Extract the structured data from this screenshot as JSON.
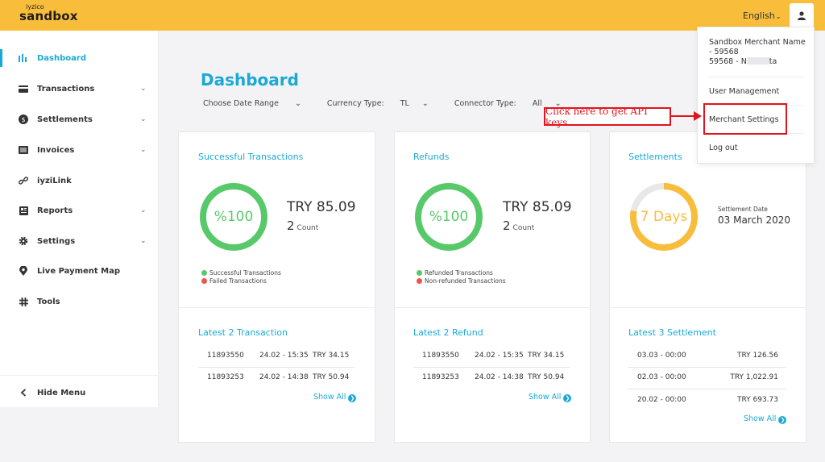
{
  "header": {
    "logo_small": "iyzico",
    "logo_big": "sandbox",
    "language": "English"
  },
  "sidebar": {
    "items": [
      {
        "label": "Dashboard",
        "icon": "bar-chart-icon",
        "active": true,
        "caret": false
      },
      {
        "label": "Transactions",
        "icon": "card-icon",
        "caret": true
      },
      {
        "label": "Settlements",
        "icon": "coin-icon",
        "caret": true
      },
      {
        "label": "Invoices",
        "icon": "list-icon",
        "caret": true
      },
      {
        "label": "iyziLink",
        "icon": "link-icon",
        "caret": false
      },
      {
        "label": "Reports",
        "icon": "report-icon",
        "caret": true
      },
      {
        "label": "Settings",
        "icon": "gear-icon",
        "caret": true
      },
      {
        "label": "Live Payment Map",
        "icon": "map-pin-icon",
        "caret": false
      },
      {
        "label": "Tools",
        "icon": "hash-icon",
        "caret": false
      }
    ],
    "hide_menu": "Hide Menu"
  },
  "main": {
    "title": "Dashboard",
    "filters": {
      "date_range": "Choose Date Range",
      "currency_label": "Currency Type:",
      "currency_value": "TL",
      "connector_label": "Connector Type:",
      "connector_value": "All"
    },
    "cards": {
      "transactions": {
        "title": "Successful Transactions",
        "percent": "%100",
        "percent_value": 100,
        "amount": "TRY 85.09",
        "count": "2",
        "count_label": "Count",
        "legend": [
          "Successful Transactions",
          "Failed Transactions"
        ],
        "latest_title": "Latest 2 Transaction",
        "rows": [
          {
            "id": "11893550",
            "date": "24.02 - 15:35",
            "amount": "TRY 34.15"
          },
          {
            "id": "11893253",
            "date": "24.02 - 14:38",
            "amount": "TRY 50.94"
          }
        ],
        "show_all": "Show All"
      },
      "refunds": {
        "title": "Refunds",
        "percent": "%100",
        "percent_value": 100,
        "amount": "TRY 85.09",
        "count": "2",
        "count_label": "Count",
        "legend": [
          "Refunded Transactions",
          "Non-refunded Transactions"
        ],
        "latest_title": "Latest 2 Refund",
        "rows": [
          {
            "id": "11893550",
            "date": "24.02 - 15:35",
            "amount": "TRY 34.15"
          },
          {
            "id": "11893253",
            "date": "24.02 - 14:38",
            "amount": "TRY 50.94"
          }
        ],
        "show_all": "Show All"
      },
      "settlements": {
        "title": "Settlements",
        "days": "7 Days",
        "progress_fraction": 0.78,
        "date_label": "Settlement Date",
        "date_value": "03 March 2020",
        "latest_title": "Latest 3 Settlement",
        "rows": [
          {
            "date": "03.03 - 00:00",
            "amount": "TRY 126.56"
          },
          {
            "date": "02.03 - 00:00",
            "amount": "TRY 1,022.91"
          },
          {
            "date": "20.02 - 00:00",
            "amount": "TRY 693.73"
          }
        ],
        "show_all": "Show All"
      }
    }
  },
  "user_menu": {
    "merchant_line1": "Sandbox Merchant Name",
    "merchant_line2": "- 59568",
    "merchant_line3_prefix": "59568 - N",
    "merchant_line3_suffix": "ta",
    "user_management": "User Management",
    "merchant_settings": "Merchant Settings",
    "log_out": "Log out"
  },
  "annotation": {
    "callout": "Click here to get API keys"
  },
  "colors": {
    "topbar": "#f8bd3b",
    "accent": "#1aa9d6",
    "success": "#58c96a",
    "failed": "#ef5350",
    "settlement": "#f8bd3b",
    "annotation": "#e0141e"
  }
}
